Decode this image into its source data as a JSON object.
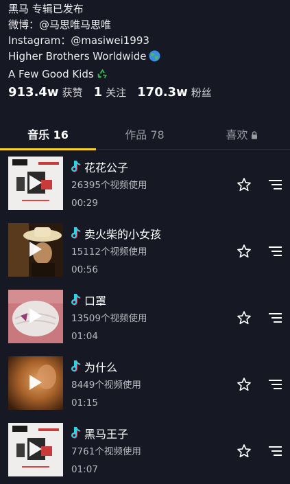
{
  "bio": {
    "line1": "黑马 专辑已发布",
    "line2": "微博：@马思唯马思唯",
    "line3": "Instagram：@masiwei1993",
    "line4": "Higher Brothers Worldwide",
    "line4_emoji": "globe-icon",
    "line5": "A Few Good Kids",
    "line5_emoji": "recycle-icon"
  },
  "stats": [
    {
      "value": "913.4w",
      "label": "获赞"
    },
    {
      "value": "1",
      "label": "关注"
    },
    {
      "value": "170.3w",
      "label": "粉丝"
    }
  ],
  "tabs": {
    "music": "音乐 16",
    "works": "作品 78",
    "likes": "喜欢",
    "likes_icon": "lock-icon",
    "active": "music"
  },
  "colors": {
    "background": "#161823",
    "accent": "#ffd41f",
    "note_cyan": "#25d7e6",
    "note_pink": "#fe2c55"
  },
  "tracks": [
    {
      "title": "花花公子",
      "usage": "26395个视频使用",
      "duration": "00:29",
      "cover": "album-cover-black-horse"
    },
    {
      "title": "卖火柴的小女孩",
      "usage": "15112个视频使用",
      "duration": "00:56",
      "cover": "cover-cowboy-hat"
    },
    {
      "title": "口罩",
      "usage": "13509个视频使用",
      "duration": "01:04",
      "cover": "cover-face-mask"
    },
    {
      "title": "为什么",
      "usage": "8449个视频使用",
      "duration": "01:15",
      "cover": "cover-blurred-portrait"
    },
    {
      "title": "黑马王子",
      "usage": "7761个视频使用",
      "duration": "01:07",
      "cover": "album-cover-black-horse"
    }
  ]
}
